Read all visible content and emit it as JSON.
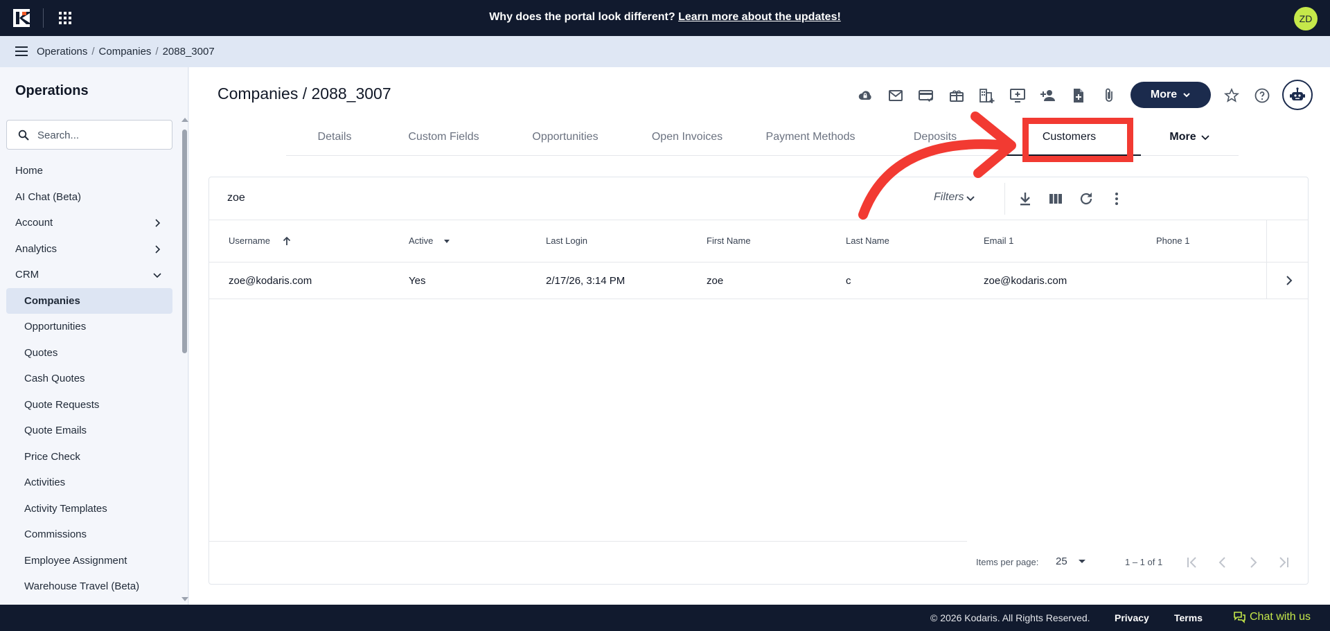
{
  "topbar": {
    "announcement_prefix": "Why does the portal look different? ",
    "announcement_link": "Learn more about the updates!",
    "avatar_initials": "ZD",
    "accent_color": "#c5e84a"
  },
  "breadcrumb": {
    "items": [
      "Operations",
      "Companies",
      "2088_3007"
    ],
    "separator": "/"
  },
  "sidebar": {
    "title": "Operations",
    "search_placeholder": "Search...",
    "items": [
      {
        "label": "Home",
        "level": 0
      },
      {
        "label": "AI Chat (Beta)",
        "level": 0
      },
      {
        "label": "Account",
        "level": 0,
        "icon": "chevron-right-icon"
      },
      {
        "label": "Analytics",
        "level": 0,
        "icon": "chevron-right-icon"
      },
      {
        "label": "CRM",
        "level": 0,
        "icon": "chevron-down-icon"
      },
      {
        "label": "Companies",
        "level": 1,
        "active": true
      },
      {
        "label": "Opportunities",
        "level": 1
      },
      {
        "label": "Quotes",
        "level": 1
      },
      {
        "label": "Cash Quotes",
        "level": 1
      },
      {
        "label": "Quote Requests",
        "level": 1
      },
      {
        "label": "Quote Emails",
        "level": 1
      },
      {
        "label": "Price Check",
        "level": 1
      },
      {
        "label": "Activities",
        "level": 1
      },
      {
        "label": "Activity Templates",
        "level": 1
      },
      {
        "label": "Commissions",
        "level": 1
      },
      {
        "label": "Employee Assignment",
        "level": 1
      },
      {
        "label": "Warehouse Travel (Beta)",
        "level": 1
      }
    ]
  },
  "main": {
    "title": "Companies / 2088_3007",
    "toolbar_icons": [
      "cloud-lock-icon",
      "email-icon",
      "card-check-icon",
      "gift-card-icon",
      "building-add-icon",
      "add-to-queue-icon",
      "person-add-icon",
      "note-add-icon",
      "attachment-icon"
    ],
    "more_label": "More",
    "tabs": [
      "Details",
      "Custom Fields",
      "Opportunities",
      "Open Invoices",
      "Payment Methods",
      "Deposits",
      "Customers"
    ],
    "selected_tab": "Customers",
    "more_tab_label": "More"
  },
  "table": {
    "search_value": "zoe",
    "filters_label": "Filters",
    "columns": [
      "Username",
      "Active",
      "Last Login",
      "First Name",
      "Last Name",
      "Email 1",
      "Phone 1"
    ],
    "rows": [
      [
        "zoe@kodaris.com",
        "Yes",
        "2/17/26, 3:14 PM",
        "zoe",
        "c",
        "zoe@kodaris.com",
        ""
      ]
    ],
    "paginator": {
      "items_per_page_label": "Items per page:",
      "page_size": "25",
      "range": "1 – 1 of 1"
    }
  },
  "annotation": {
    "color": "#f23a32"
  },
  "footer": {
    "copyright": "© 2026 Kodaris. All Rights Reserved.",
    "privacy": "Privacy",
    "terms": "Terms",
    "chat": "Chat with us"
  }
}
